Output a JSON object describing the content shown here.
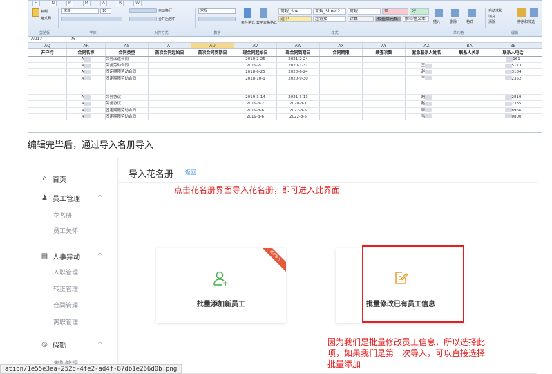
{
  "excel": {
    "ribbon_tabs": [
      "H",
      "N",
      "P",
      "M",
      "A",
      "R",
      "W"
    ],
    "font_name": "宋体",
    "font_size": "10",
    "clip_items": [
      "复制",
      "格式刷"
    ],
    "wrap_label": "自动换行",
    "merge_label": "合并后居中",
    "number_format": "常规",
    "group_labels": [
      "剪贴板",
      "字体",
      "对齐方式",
      "数字",
      "样式",
      "单元格",
      "编辑"
    ],
    "cond_label": "条件格式",
    "table_label": "套用表格格式",
    "style_cells": [
      {
        "text": "常规_She...",
        "bg": "#ffffff"
      },
      {
        "text": "常规_Sheet2",
        "bg": "#ffffff"
      },
      {
        "text": "常规",
        "bg": "#ffffff"
      },
      {
        "text": "差",
        "bg": "#ffc7ce"
      },
      {
        "text": "好",
        "bg": "#c6efce"
      },
      {
        "text": "适中",
        "bg": "#ffeb9c"
      },
      {
        "text": "超链接",
        "bg": "#ffffff"
      },
      {
        "text": "计算",
        "bg": "#f2f2f2"
      },
      {
        "text": "检查单元格",
        "bg": "#a5a5a5"
      },
      {
        "text": "解释性文本",
        "bg": "#ffffff"
      }
    ],
    "cell_actions": [
      "插入",
      "删除",
      "格式"
    ],
    "edit_actions": [
      "自动求和",
      "填充",
      "清除",
      "排序和筛选",
      "查找和选择"
    ],
    "name_box": "AU17",
    "fx": "fx",
    "columns": [
      "AQ",
      "AR",
      "AS",
      "AT",
      "AU",
      "AV",
      "AW",
      "AX",
      "AY",
      "AZ",
      "BA",
      "BB"
    ],
    "selected_column": "AU",
    "headers": [
      "开户行",
      "合同名称",
      "合同类型",
      "首次合同起始日",
      "首次合同到期日",
      "现合同起始日",
      "现合同到期日",
      "合同期限",
      "续签次数",
      "紧急联系人姓名",
      "联系人关系",
      "联系人电话"
    ],
    "rows": [
      {
        "a": "A",
        "type": "劳务派遣合同",
        "s": "2019-2-25",
        "e": "2021-2-24",
        "z": "",
        "p": "161"
      },
      {
        "a": "A",
        "type": "劳务劳动合同",
        "s": "2019-2-1",
        "e": "2020-1-31",
        "z": "王",
        "p": "5173"
      },
      {
        "a": "A",
        "type": "固定期限劳动合同",
        "s": "2018-6-25",
        "e": "2020-6-24",
        "z": "赵",
        "p": "3184"
      },
      {
        "a": "A",
        "type": "固定期限劳动合同",
        "s": "2018-10-1",
        "e": "2020-9-30",
        "z": "王",
        "p": "2352"
      },
      {
        "a": "",
        "type": "",
        "s": "",
        "e": "",
        "z": "",
        "p": ""
      },
      {
        "a": "",
        "type": "",
        "s": "",
        "e": "",
        "z": "",
        "p": ""
      },
      {
        "a": "A",
        "type": "劳务协议",
        "s": "2019-3-14",
        "e": "2021-3-13",
        "z": "胡",
        "p": "2819"
      },
      {
        "a": "A",
        "type": "劳务协议",
        "s": "2019-3-2",
        "e": "2020-3-1",
        "z": "赵",
        "p": "2335"
      },
      {
        "a": "A",
        "type": "固定期限劳动合同",
        "s": "2019-3-6",
        "e": "2022-3-5",
        "z": "李",
        "p": "8966"
      },
      {
        "a": "A",
        "type": "固定期限劳动合同",
        "s": "2019-3-6",
        "e": "2022-3-5",
        "z": "韦",
        "p": "0800"
      }
    ]
  },
  "caption": "编辑完毕后，通过导入名册导入",
  "app": {
    "nav": [
      {
        "label": "首页",
        "icon": "home-icon"
      },
      {
        "label": "员工管理",
        "icon": "users-icon",
        "children": [
          "花名册",
          "员工关怀"
        ]
      },
      {
        "label": "人事异动",
        "icon": "document-icon",
        "children": [
          "入职管理",
          "转正管理",
          "合同管理",
          "离职管理"
        ]
      },
      {
        "label": "假勤",
        "icon": "calendar-icon",
        "children": [
          "考勤管理"
        ]
      }
    ],
    "page_title": "导入花名册",
    "back_link": "返回",
    "annotation_top": "点击花名册界面导入花名册，即可进入此界面",
    "card_add": "批量添加新员工",
    "card_add_badge": "首次导入",
    "card_edit": "批量修改已有员工信息",
    "annotation_bottom": [
      "因为我们是批量修改员工信息，所以选择此",
      "项，如果我们是第一次导入，可以直接选择",
      "批量添加"
    ]
  },
  "status_tooltip": "ation/1e55e3ea-252d-4fe2-ad4f-87db1e266d0b.png",
  "colors": {
    "accent_green": "#4caf50",
    "accent_orange": "#f0a030",
    "annotation_red": "#e02020",
    "link_blue": "#3b8ee0"
  }
}
